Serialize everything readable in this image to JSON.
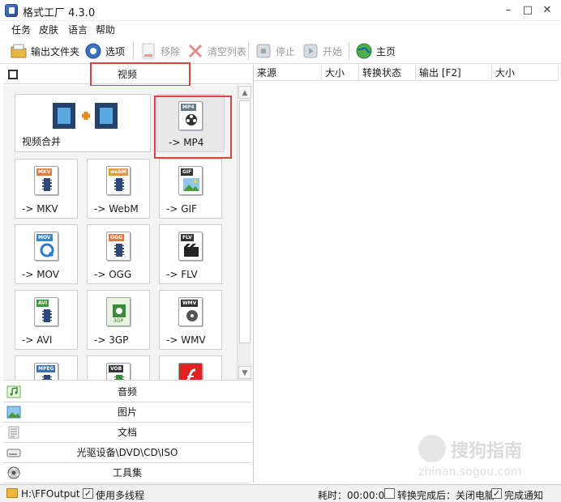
{
  "window": {
    "title": "格式工厂 4.3.0",
    "minimize": "–",
    "maximize": "□",
    "close": "✕"
  },
  "menu": [
    "任务",
    "皮肤",
    "语言",
    "帮助"
  ],
  "toolbar": {
    "output_folder": "输出文件夹",
    "options": "选项",
    "remove": "移除",
    "clear_list": "清空列表",
    "stop": "停止",
    "start": "开始",
    "home": "主页"
  },
  "categories": {
    "video": "视频",
    "audio": "音频",
    "image": "图片",
    "document": "文档",
    "disc": "光驱设备\\DVD\\CD\\ISO",
    "tools": "工具集"
  },
  "video_tiles": {
    "merge": "视频合并",
    "mp4": "-> MP4",
    "mp4_tag": "MP4",
    "mkv": "-> MKV",
    "mkv_tag": "MKV",
    "webm": "-> WebM",
    "webm_tag": "webM",
    "gif": "-> GIF",
    "gif_tag": "GIF",
    "mov": "-> MOV",
    "mov_tag": "MOV",
    "ogg": "-> OGG",
    "ogg_tag": "OGG",
    "flv": "-> FLV",
    "flv_tag": "FLV",
    "avi": "-> AVI",
    "avi_tag": "AVI",
    "3gp": "-> 3GP",
    "3gp_tag": "3GP",
    "wmv": "-> WMV",
    "wmv_tag": "WMV",
    "mpeg_tag": "MPEG",
    "vob_tag": "VOB"
  },
  "task_columns": [
    "来源",
    "大小",
    "转换状态",
    "输出 [F2]",
    "大小"
  ],
  "status": {
    "output_path": "H:\\FFOutput",
    "multithread": "使用多线程",
    "elapsed": "耗时：00:00:00",
    "after_done": "转换完成后：关闭电脑",
    "notify": "完成通知",
    "check_mark": "✓"
  },
  "watermark": {
    "text": "搜狗指南",
    "url": "zhinan.sogou.com"
  },
  "colors": {
    "highlight": "#d9463c",
    "accent": "#2e4a7d"
  }
}
